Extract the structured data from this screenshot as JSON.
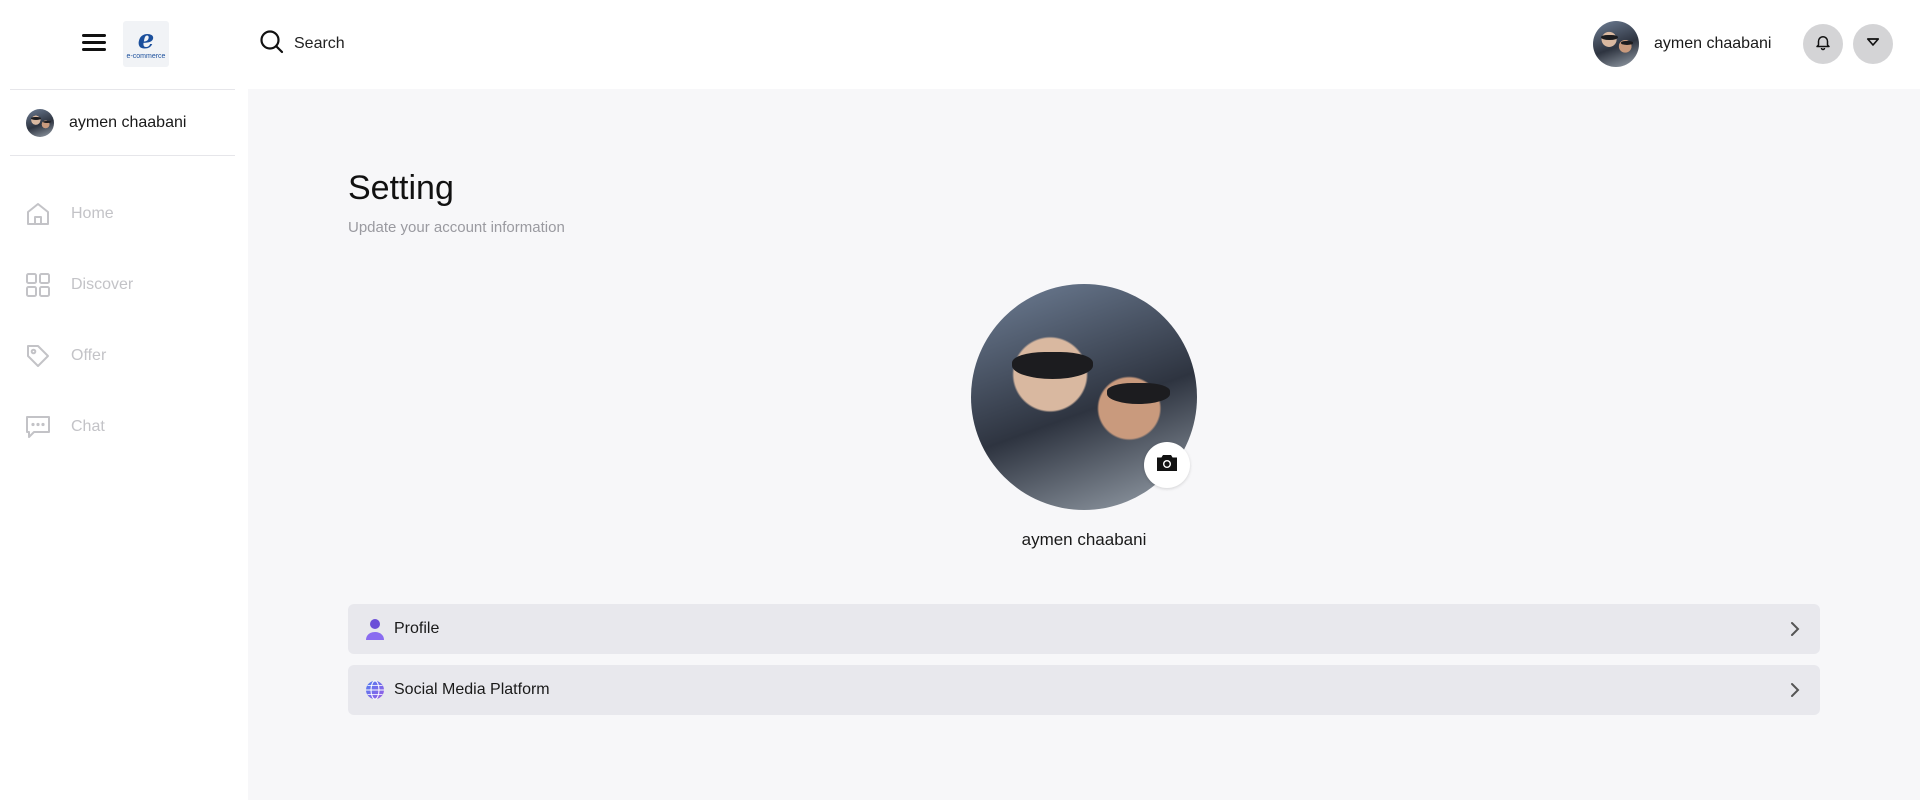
{
  "header": {
    "logo": {
      "mark": "e",
      "text": "e-commerce"
    },
    "search_placeholder": "Search",
    "user_name": "aymen chaabani"
  },
  "sidebar": {
    "user_name": "aymen chaabani",
    "items": [
      {
        "label": "Home",
        "icon": "home-icon"
      },
      {
        "label": "Discover",
        "icon": "grid-icon"
      },
      {
        "label": "Offer",
        "icon": "tag-icon"
      },
      {
        "label": "Chat",
        "icon": "chat-icon"
      }
    ]
  },
  "main": {
    "title": "Setting",
    "subtitle": "Update your account information",
    "profile_name": "aymen chaabani",
    "rows": [
      {
        "label": "Profile",
        "icon": "user-icon"
      },
      {
        "label": "Social Media Platform",
        "icon": "globe-icon"
      }
    ]
  },
  "colors": {
    "main_background": "#f7f7f9",
    "row_background": "#e8e8ed",
    "nav_inactive": "#c3c3c7",
    "header_button": "#d4d4d6",
    "profile_icon_accent": "#6b4fd8"
  }
}
